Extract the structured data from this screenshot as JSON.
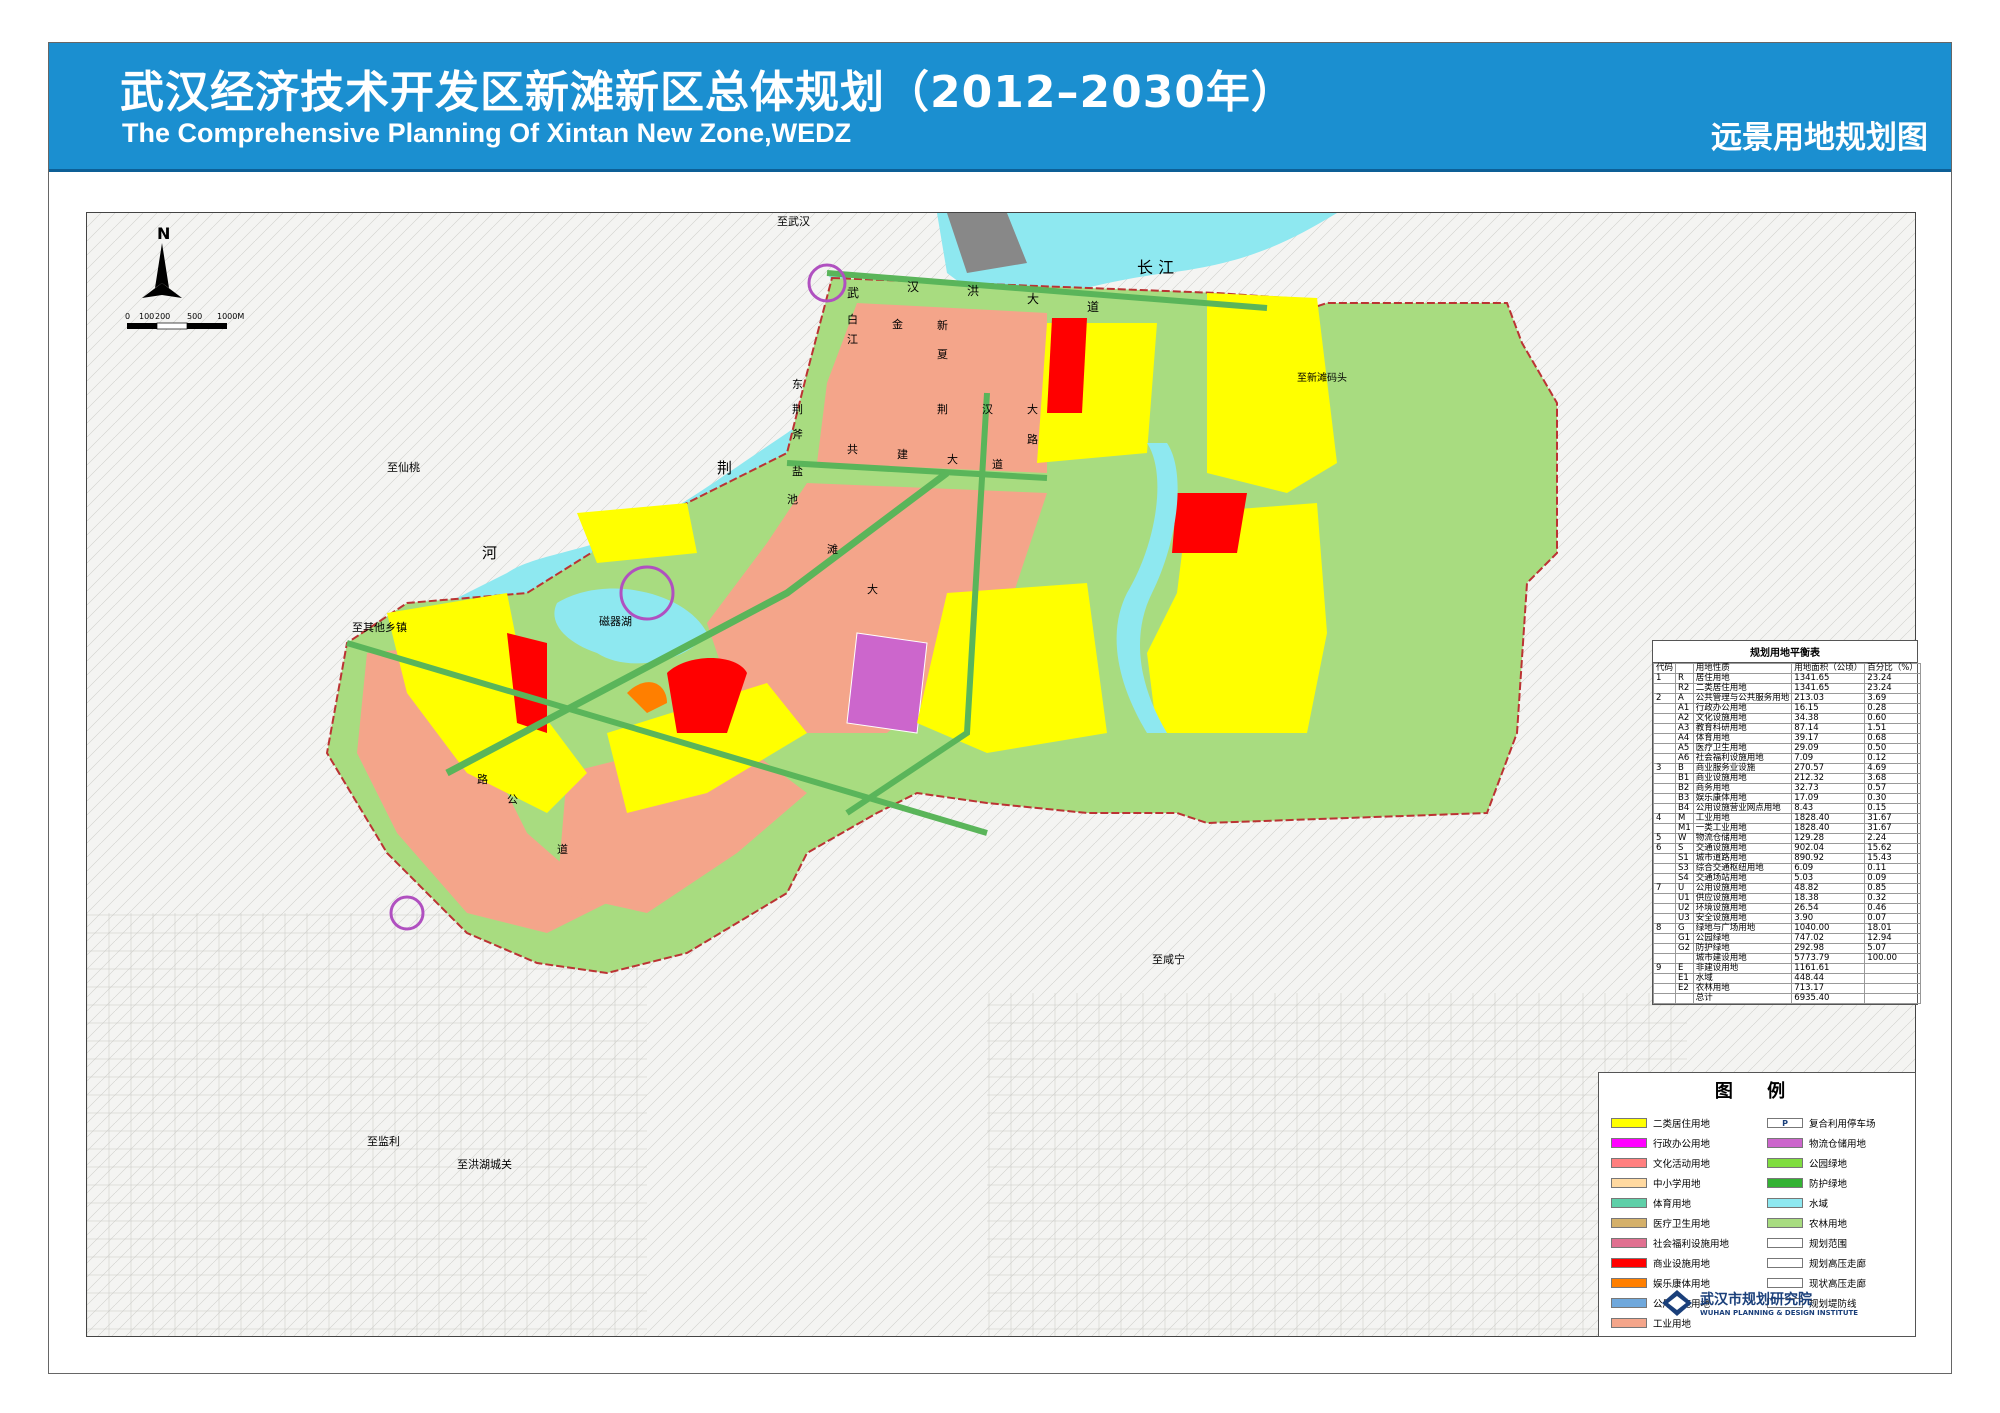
{
  "header": {
    "title_cn": "武汉经济技术开发区新滩新区总体规划（2012–2030年）",
    "title_en": "The Comprehensive Planning Of Xintan New Zone,WEDZ",
    "subtitle": "远景用地规划图"
  },
  "compass": {
    "north_label": "N"
  },
  "scale_bar": {
    "labels": [
      "0",
      "100",
      "200",
      "500",
      "1000M"
    ]
  },
  "map_labels": {
    "to_wuhan": "至武汉",
    "to_xiantao": "至仙桃",
    "to_qita": "至其他乡镇",
    "to_xianning": "至咸宁",
    "to_jianli": "至监利",
    "to_honghu": "至洪湖城关",
    "to_pier": "至新滩码头",
    "river": "长 江",
    "lake": "磁器湖",
    "river_chars": [
      "荆",
      "河"
    ],
    "road_chars_1": [
      "武",
      "汉",
      "洪",
      "大",
      "道"
    ],
    "road_chars_2": [
      "白",
      "江",
      "金",
      "新",
      "夏"
    ],
    "road_chars_3": [
      "共",
      "建",
      "大",
      "道"
    ],
    "road_chars_4": [
      "荆",
      "汉",
      "大",
      "路"
    ],
    "road_chars_5": [
      "东",
      "荆",
      "斧",
      "盐"
    ],
    "road_chars_6": [
      "池",
      "滩",
      "大"
    ],
    "road_chars_7": [
      "公",
      "路",
      "道"
    ]
  },
  "balance_table": {
    "title": "规划用地平衡表",
    "headers": [
      "代码",
      "",
      "用地性质",
      "用地面积（公顷）",
      "百分比（%）"
    ],
    "rows": [
      [
        "1",
        "R",
        "居住用地",
        "1341.65",
        "23.24"
      ],
      [
        "",
        "R2",
        "二类居住用地",
        "1341.65",
        "23.24"
      ],
      [
        "2",
        "A",
        "公共管理与公共服务用地",
        "213.03",
        "3.69"
      ],
      [
        "",
        "A1",
        "行政办公用地",
        "16.15",
        "0.28"
      ],
      [
        "",
        "A2",
        "文化设施用地",
        "34.38",
        "0.60"
      ],
      [
        "",
        "A3",
        "教育科研用地",
        "87.14",
        "1.51"
      ],
      [
        "",
        "A4",
        "体育用地",
        "39.17",
        "0.68"
      ],
      [
        "",
        "A5",
        "医疗卫生用地",
        "29.09",
        "0.50"
      ],
      [
        "",
        "A6",
        "社会福利设施用地",
        "7.09",
        "0.12"
      ],
      [
        "3",
        "B",
        "商业服务业设施",
        "270.57",
        "4.69"
      ],
      [
        "",
        "B1",
        "商业设施用地",
        "212.32",
        "3.68"
      ],
      [
        "",
        "B2",
        "商务用地",
        "32.73",
        "0.57"
      ],
      [
        "",
        "B3",
        "娱乐康体用地",
        "17.09",
        "0.30"
      ],
      [
        "",
        "B4",
        "公用设施营业网点用地",
        "8.43",
        "0.15"
      ],
      [
        "4",
        "M",
        "工业用地",
        "1828.40",
        "31.67"
      ],
      [
        "",
        "M1",
        "一类工业用地",
        "1828.40",
        "31.67"
      ],
      [
        "5",
        "W",
        "物流仓储用地",
        "129.28",
        "2.24"
      ],
      [
        "6",
        "S",
        "交通设施用地",
        "902.04",
        "15.62"
      ],
      [
        "",
        "S1",
        "城市道路用地",
        "890.92",
        "15.43"
      ],
      [
        "",
        "S3",
        "综合交通枢纽用地",
        "6.09",
        "0.11"
      ],
      [
        "",
        "S4",
        "交通场站用地",
        "5.03",
        "0.09"
      ],
      [
        "7",
        "U",
        "公用设施用地",
        "48.82",
        "0.85"
      ],
      [
        "",
        "U1",
        "供应设施用地",
        "18.38",
        "0.32"
      ],
      [
        "",
        "U2",
        "环境设施用地",
        "26.54",
        "0.46"
      ],
      [
        "",
        "U3",
        "安全设施用地",
        "3.90",
        "0.07"
      ],
      [
        "8",
        "G",
        "绿地与广场用地",
        "1040.00",
        "18.01"
      ],
      [
        "",
        "G1",
        "公园绿地",
        "747.02",
        "12.94"
      ],
      [
        "",
        "G2",
        "防护绿地",
        "292.98",
        "5.07"
      ],
      [
        "",
        "",
        "城市建设用地",
        "5773.79",
        "100.00"
      ],
      [
        "9",
        "E",
        "非建设用地",
        "1161.61",
        ""
      ],
      [
        "",
        "E1",
        "水域",
        "448.44",
        ""
      ],
      [
        "",
        "E2",
        "农林用地",
        "713.17",
        ""
      ],
      [
        "",
        "",
        "总计",
        "6935.40",
        ""
      ]
    ]
  },
  "legend": {
    "title": "图 例",
    "items_left": [
      {
        "label": "二类居住用地",
        "color": "#ffff00"
      },
      {
        "label": "行政办公用地",
        "color": "#ff00ff"
      },
      {
        "label": "文化活动用地",
        "color": "#ff7f7f"
      },
      {
        "label": "中小学用地",
        "color": "#ffd9a0"
      },
      {
        "label": "体育用地",
        "color": "#5ecfa8"
      },
      {
        "label": "医疗卫生用地",
        "color": "#d4b06a"
      },
      {
        "label": "社会福利设施用地",
        "color": "#e07090"
      },
      {
        "label": "商业设施用地",
        "color": "#ff0000"
      },
      {
        "label": "娱乐康体用地",
        "color": "#ff7f00"
      },
      {
        "label": "公用设施用地",
        "color": "#6fa8dc"
      },
      {
        "label": "工业用地",
        "color": "#f4a58a"
      }
    ],
    "items_right": [
      {
        "label": "复合利用停车场",
        "color": "#ffffff"
      },
      {
        "label": "物流仓储用地",
        "color": "#cc66cc"
      },
      {
        "label": "公园绿地",
        "color": "#7fdd3f"
      },
      {
        "label": "防护绿地",
        "color": "#33b233"
      },
      {
        "label": "水域",
        "color": "#8ee8f0"
      },
      {
        "label": "农林用地",
        "color": "#a8dc80"
      },
      {
        "label": "规划范围",
        "color": "#ffffff"
      },
      {
        "label": "规划高压走廊",
        "color": "#ffffff"
      },
      {
        "label": "现状高压走廊",
        "color": "#ffffff"
      },
      {
        "label": "规划堤防线",
        "color": "#ffffff"
      }
    ],
    "parking_symbol": "P"
  },
  "institute": {
    "name_cn": "武汉市规划研究院",
    "name_en": "WUHAN PLANNING & DESIGN INSTITUTE"
  }
}
